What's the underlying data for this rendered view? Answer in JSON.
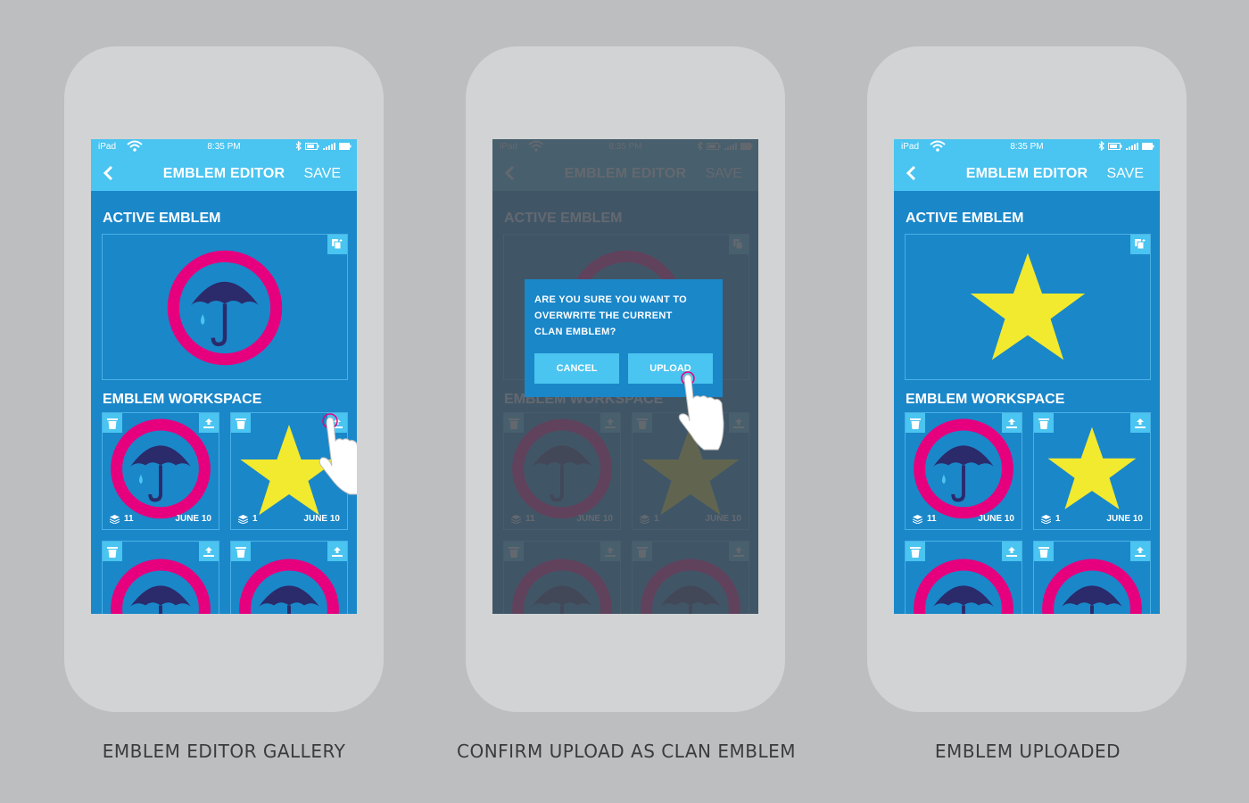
{
  "status": {
    "carrier": "iPad",
    "time": "8:35 PM"
  },
  "nav": {
    "title": "EMBLEM EDITOR",
    "save": "SAVE"
  },
  "sections": {
    "active": "ACTIVE EMBLEM",
    "workspace": "EMBLEM WORKSPACE"
  },
  "tiles": [
    {
      "count": "11",
      "date": "JUNE 10",
      "emblem": "umbrella"
    },
    {
      "count": "1",
      "date": "JUNE 10",
      "emblem": "star"
    },
    {
      "count": "",
      "date": "",
      "emblem": "umbrella"
    },
    {
      "count": "",
      "date": "",
      "emblem": "umbrella"
    }
  ],
  "dialog": {
    "message_lines": [
      "ARE YOU SURE YOU WANT TO",
      "OVERWRITE THE CURRENT",
      "CLAN EMBLEM?"
    ],
    "cancel": "CANCEL",
    "upload": "UPLOAD"
  },
  "captions": {
    "gallery": "EMBLEM EDITOR GALLERY",
    "confirm": "CONFIRM UPLOAD AS CLAN EMBLEM",
    "uploaded": "EMBLEM UPLOADED"
  },
  "colors": {
    "nav_bar": "#4ac4f0",
    "screen_bg": "#1a87c9",
    "ring": "#e6007e",
    "umbrella": "#2b2a6b",
    "star": "#f2ea2e"
  },
  "icons": [
    "back-chevron-icon",
    "wifi-icon",
    "bluetooth-icon",
    "battery-icon",
    "signal-icon",
    "duplicate-icon",
    "delete-icon",
    "upload-icon",
    "layers-icon",
    "hand-pointer-icon"
  ]
}
